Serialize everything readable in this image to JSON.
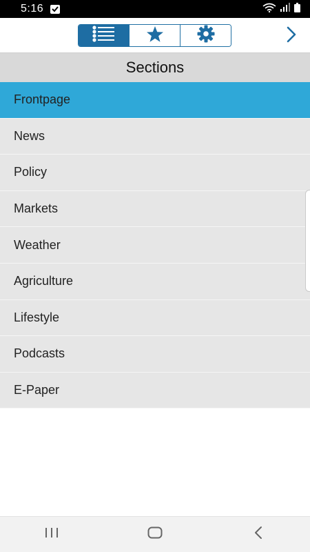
{
  "status_bar": {
    "time": "5:16",
    "notification_icon": "message-icon",
    "wifi_icon": "wifi-icon",
    "signal_icon": "signal-icon",
    "battery_icon": "battery-icon"
  },
  "toolbar": {
    "segments": [
      {
        "icon": "list-icon",
        "active": true
      },
      {
        "icon": "star-icon",
        "active": false
      },
      {
        "icon": "gear-icon",
        "active": false
      }
    ],
    "next_icon": "chevron-right-icon"
  },
  "sections": {
    "title": "Sections",
    "items": [
      {
        "label": "Frontpage",
        "selected": true
      },
      {
        "label": "News",
        "selected": false
      },
      {
        "label": "Policy",
        "selected": false
      },
      {
        "label": "Markets",
        "selected": false
      },
      {
        "label": "Weather",
        "selected": false
      },
      {
        "label": "Agriculture",
        "selected": false
      },
      {
        "label": "Lifestyle",
        "selected": false
      },
      {
        "label": "Podcasts",
        "selected": false
      },
      {
        "label": "E-Paper",
        "selected": false
      }
    ]
  },
  "colors": {
    "accent": "#1e6da3",
    "selected_row": "#2fa8d8",
    "row_bg": "#e6e6e6",
    "header_bg": "#d9d9d9"
  },
  "nav": {
    "recents_icon": "recents-icon",
    "home_icon": "home-icon",
    "back_icon": "back-icon"
  }
}
